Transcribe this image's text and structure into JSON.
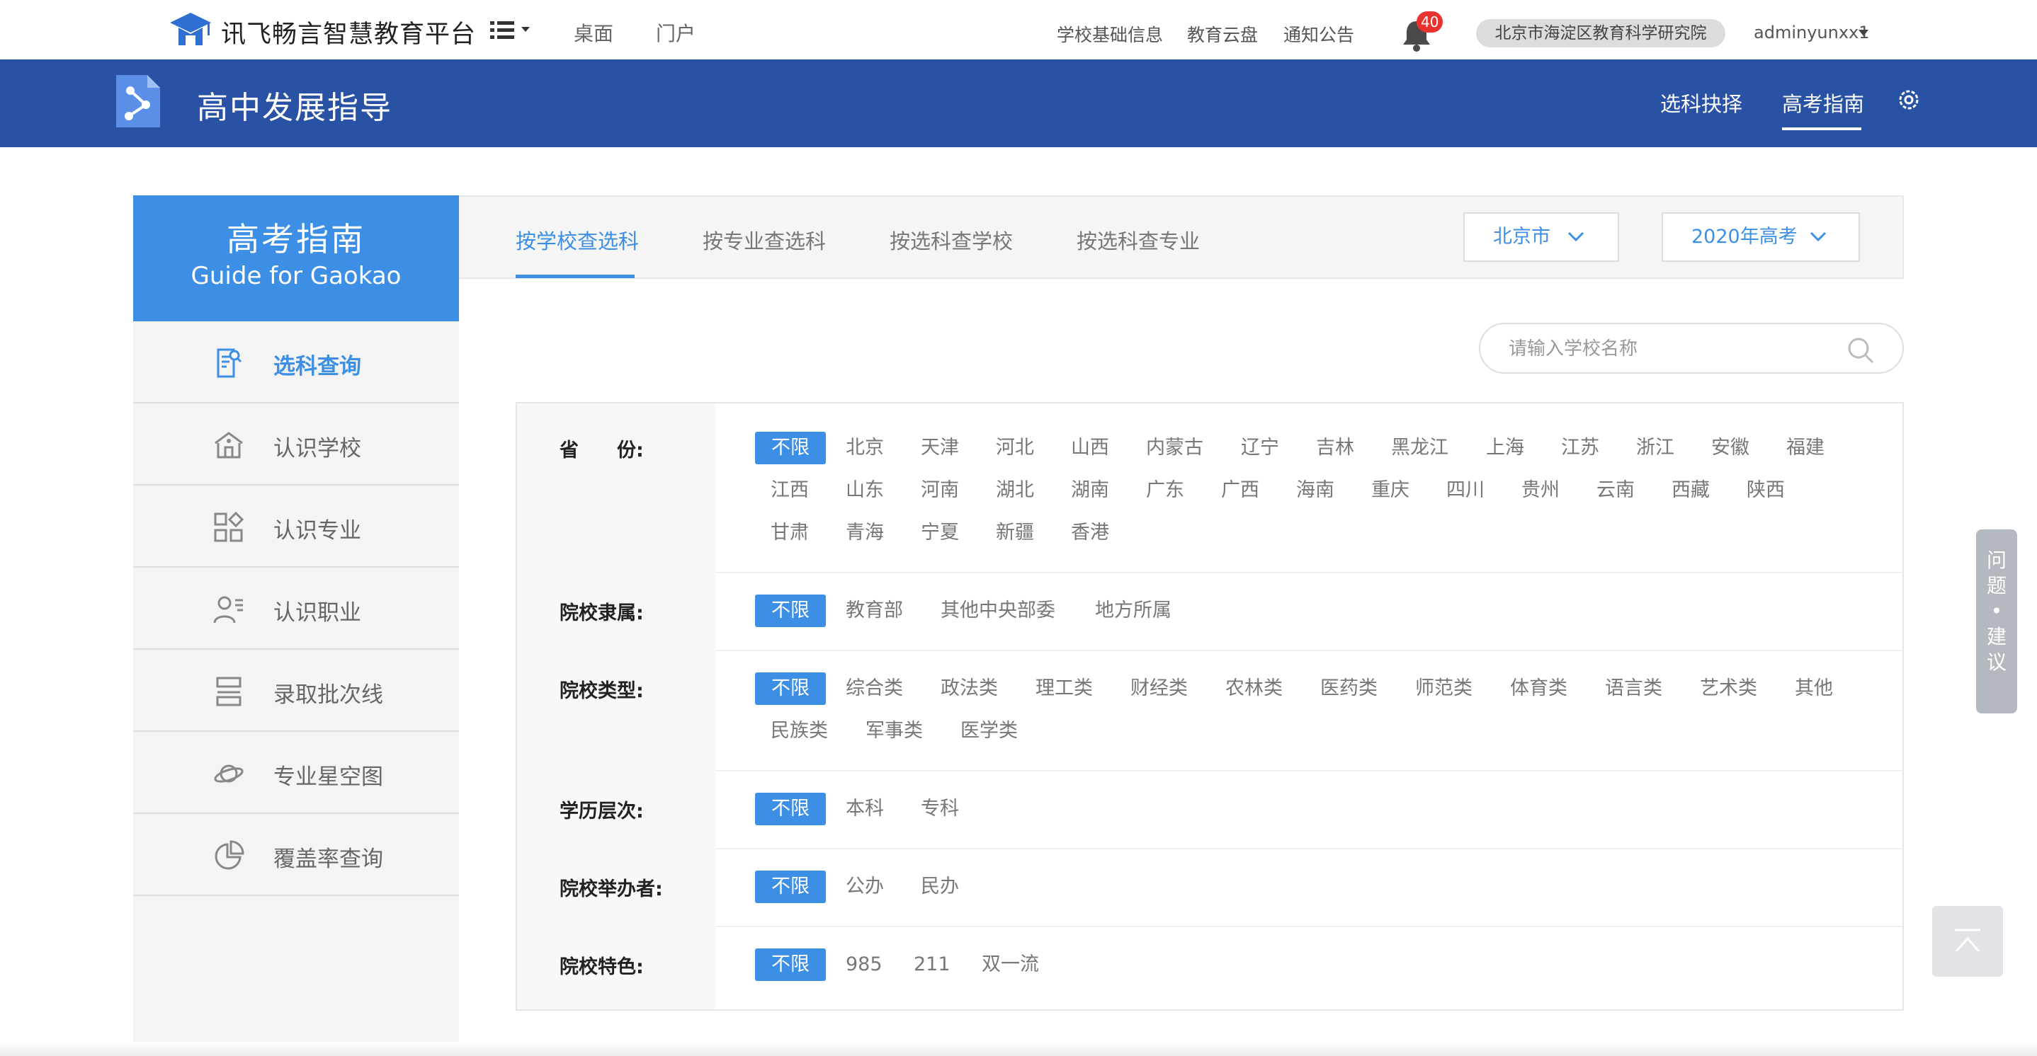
{
  "topbar": {
    "brand": "讯飞畅言智慧教育平台",
    "nav": [
      "桌面",
      "门户"
    ],
    "links": [
      "学校基础信息",
      "教育云盘",
      "通知公告"
    ],
    "notification_count": "40",
    "org": "北京市海淀区教育科学研究院",
    "user": "adminyunxx1"
  },
  "header": {
    "title": "高中发展指导",
    "tabs": [
      "选科抉择",
      "高考指南"
    ],
    "active_tab": "高考指南"
  },
  "sidebar": {
    "title": "高考指南",
    "subtitle": "Guide for Gaokao",
    "items": [
      {
        "label": "选科查询",
        "icon": "document-search-icon",
        "active": true
      },
      {
        "label": "认识学校",
        "icon": "school-icon",
        "active": false
      },
      {
        "label": "认识专业",
        "icon": "grid-icon",
        "active": false
      },
      {
        "label": "认识职业",
        "icon": "person-icon",
        "active": false
      },
      {
        "label": "录取批次线",
        "icon": "list-icon",
        "active": false
      },
      {
        "label": "专业星空图",
        "icon": "planet-icon",
        "active": false
      },
      {
        "label": "覆盖率查询",
        "icon": "pie-chart-icon",
        "active": false
      }
    ]
  },
  "main": {
    "tabs": [
      "按学校查选科",
      "按专业查选科",
      "按选科查学校",
      "按选科查专业"
    ],
    "active_tab": "按学校查选科",
    "region_select": "北京市",
    "year_select": "2020年高考",
    "search_placeholder": "请输入学校名称"
  },
  "filters": [
    {
      "label": "省　　份:",
      "options": [
        "不限",
        "北京",
        "天津",
        "河北",
        "山西",
        "内蒙古",
        "辽宁",
        "吉林",
        "黑龙江",
        "上海",
        "江苏",
        "浙江",
        "安徽",
        "福建",
        "江西",
        "山东",
        "河南",
        "湖北",
        "湖南",
        "广东",
        "广西",
        "海南",
        "重庆",
        "四川",
        "贵州",
        "云南",
        "西藏",
        "陕西",
        "甘肃",
        "青海",
        "宁夏",
        "新疆",
        "香港"
      ],
      "selected": "不限"
    },
    {
      "label": "院校隶属:",
      "options": [
        "不限",
        "教育部",
        "其他中央部委",
        "地方所属"
      ],
      "selected": "不限"
    },
    {
      "label": "院校类型:",
      "options": [
        "不限",
        "综合类",
        "政法类",
        "理工类",
        "财经类",
        "农林类",
        "医药类",
        "师范类",
        "体育类",
        "语言类",
        "艺术类",
        "其他",
        "民族类",
        "军事类",
        "医学类"
      ],
      "selected": "不限"
    },
    {
      "label": "学历层次:",
      "options": [
        "不限",
        "本科",
        "专科"
      ],
      "selected": "不限"
    },
    {
      "label": "院校举办者:",
      "options": [
        "不限",
        "公办",
        "民办"
      ],
      "selected": "不限"
    },
    {
      "label": "院校特色:",
      "options": [
        "不限",
        "985",
        "211",
        "双一流"
      ],
      "selected": "不限"
    }
  ],
  "feedback": [
    "问",
    "题",
    "•",
    "建",
    "议"
  ],
  "colors": {
    "brand_blue": "#2952a4",
    "accent": "#3d8fe5",
    "badge_red": "#e8322e"
  }
}
